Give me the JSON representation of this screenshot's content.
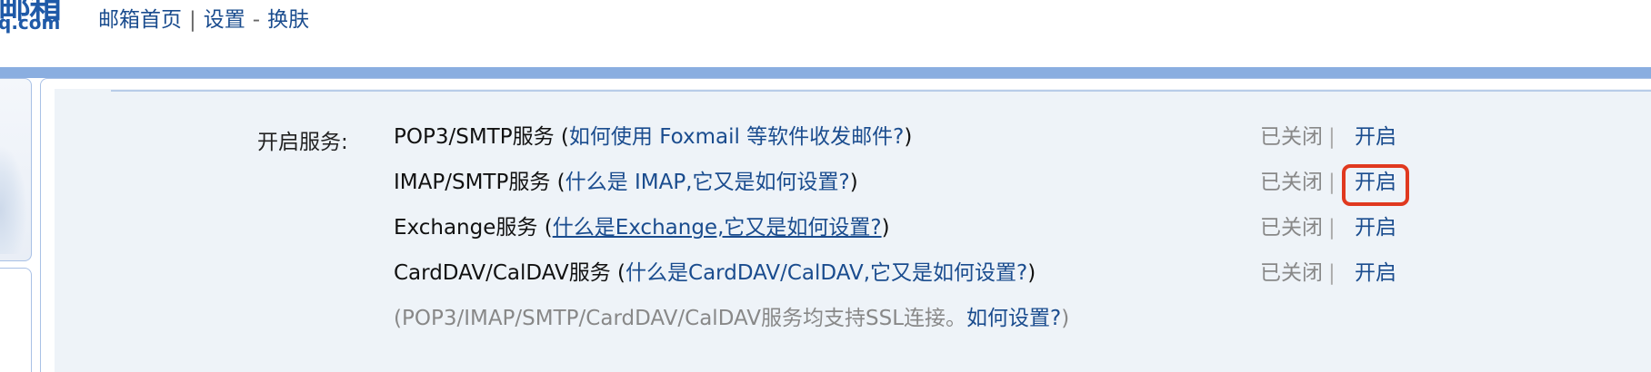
{
  "header": {
    "logo_text": "邮箱",
    "logo_domain": "q.com",
    "nav": {
      "home": "邮箱首页",
      "separator": "|",
      "settings": "设置",
      "dash": "-",
      "skin": "换肤"
    }
  },
  "services": {
    "label": "开启服务:",
    "rows": [
      {
        "name": "POP3/SMTP服务",
        "open_paren": "(",
        "help": "如何使用 Foxmail 等软件收发邮件?",
        "close_paren": ")",
        "status": "已关闭",
        "divider": "|",
        "action": "开启"
      },
      {
        "name": "IMAP/SMTP服务",
        "open_paren": "(",
        "help": "什么是 IMAP,它又是如何设置?",
        "close_paren": ")",
        "status": "已关闭",
        "divider": "|",
        "action": "开启"
      },
      {
        "name": "Exchange服务",
        "open_paren": "(",
        "help": "什么是Exchange,它又是如何设置?",
        "close_paren": ")",
        "status": "已关闭",
        "divider": "|",
        "action": "开启"
      },
      {
        "name": "CardDAV/CalDAV服务",
        "open_paren": "(",
        "help": "什么是CardDAV/CalDAV,它又是如何设置?",
        "close_paren": ")",
        "status": "已关闭",
        "divider": "|",
        "action": "开启"
      }
    ],
    "note": {
      "text": "(POP3/IMAP/SMTP/CardDAV/CalDAV服务均支持SSL连接。",
      "help": "如何设置?",
      "close": ")"
    },
    "highlight_color": "#e0391f"
  }
}
